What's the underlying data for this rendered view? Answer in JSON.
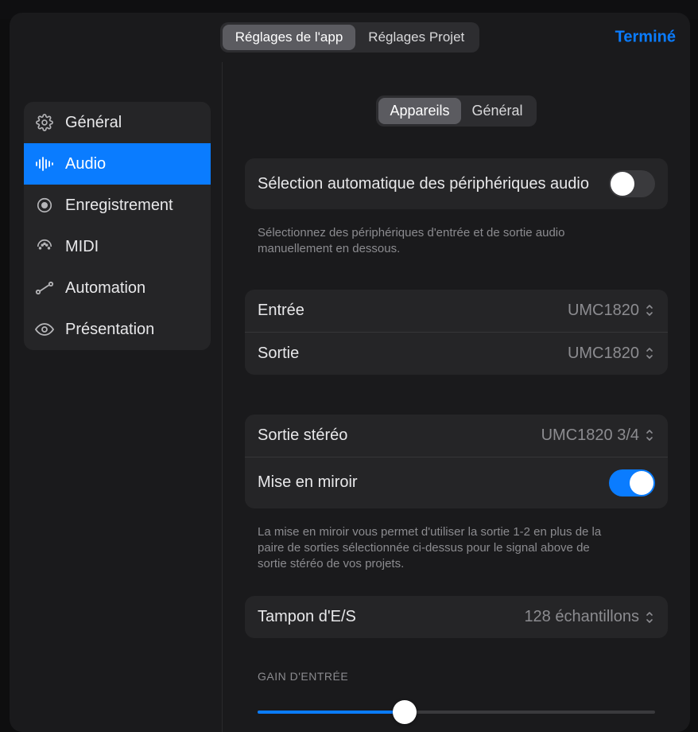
{
  "header": {
    "tabs": {
      "app": "Réglages de l'app",
      "project": "Réglages Projet"
    },
    "done": "Terminé"
  },
  "sidebar": {
    "items": [
      {
        "label": "Général"
      },
      {
        "label": "Audio"
      },
      {
        "label": "Enregistrement"
      },
      {
        "label": "MIDI"
      },
      {
        "label": "Automation"
      },
      {
        "label": "Présentation"
      }
    ]
  },
  "subTabs": {
    "devices": "Appareils",
    "general": "Général"
  },
  "autoSelect": {
    "label": "Sélection automatique des périphériques audio",
    "on": false,
    "help": "Sélectionnez des périphériques d'entrée et de sortie audio manuellement en dessous."
  },
  "io": {
    "input": {
      "label": "Entrée",
      "value": "UMC1820"
    },
    "output": {
      "label": "Sortie",
      "value": "UMC1820"
    }
  },
  "stereo": {
    "output": {
      "label": "Sortie stéréo",
      "value": "UMC1820 3/4"
    },
    "mirror": {
      "label": "Mise en miroir",
      "on": true
    },
    "help": "La mise en miroir vous permet d'utiliser la sortie 1-2 en plus de la paire de sorties sélectionnée ci-dessus pour le signal above de sortie stéréo de vos projets."
  },
  "buffer": {
    "label": "Tampon d'E/S",
    "value": "128 échantillons"
  },
  "gain": {
    "label": "GAIN D'ENTRÉE",
    "percent": 37
  }
}
